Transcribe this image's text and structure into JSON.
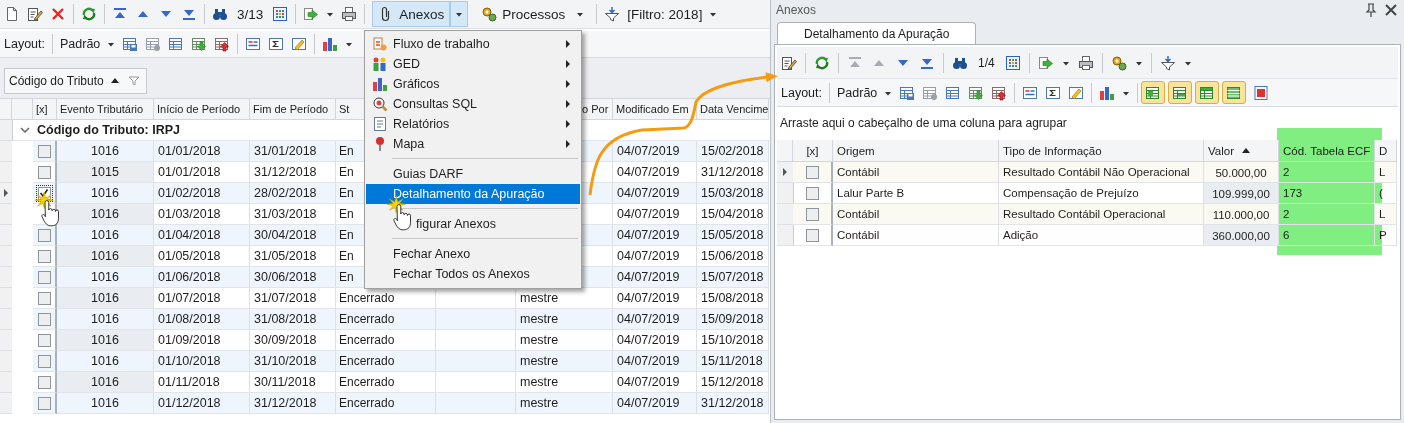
{
  "left": {
    "toolbar": {
      "record_position": "3/13",
      "anexos_button": {
        "label": "Anexos",
        "pressed": true
      },
      "processos_button": {
        "label": "Processos",
        "pressed": false
      },
      "filter_label": "[Filtro: 2018]"
    },
    "layout_bar": {
      "label": "Layout:",
      "preset": "Padrão"
    },
    "group_panel": {
      "chip": {
        "label": "Código do Tributo",
        "sorted_ascending": true
      }
    },
    "table": {
      "columns": [
        {
          "label": "[x]"
        },
        {
          "label": "Evento Tributário"
        },
        {
          "label": "Início de Período"
        },
        {
          "label": "Fim de Período"
        },
        {
          "label": "St"
        },
        {
          "label": "o Por"
        },
        {
          "label": "Modificado Em"
        },
        {
          "label": "Data Vencime"
        }
      ],
      "group": {
        "label": "Código do Tributo: IRPJ",
        "expanded": true
      },
      "rows": [
        {
          "current": false,
          "checked": false,
          "evento": "1016",
          "inicio": "01/01/2018",
          "fim": "31/01/2018",
          "status": "En",
          "modificado_em": "04/07/2019",
          "vencimento": "15/02/2018"
        },
        {
          "current": false,
          "checked": false,
          "evento": "1015",
          "inicio": "01/01/2018",
          "fim": "31/12/2018",
          "status": "En",
          "modificado_em": "04/07/2019",
          "vencimento": "31/12/2018"
        },
        {
          "current": true,
          "checked": true,
          "evento": "1016",
          "inicio": "01/02/2018",
          "fim": "28/02/2018",
          "status": "En",
          "modificado_em": "04/07/2019",
          "vencimento": "15/03/2018"
        },
        {
          "current": false,
          "evento": "1016",
          "inicio": "01/03/2018",
          "fim": "31/03/2018",
          "status": "En",
          "modificado_em": "04/07/2019",
          "vencimento": "15/04/2018"
        },
        {
          "current": false,
          "checked": false,
          "evento": "1016",
          "inicio": "01/04/2018",
          "fim": "30/04/2018",
          "status": "En",
          "modificado_em": "04/07/2019",
          "vencimento": "15/05/2018"
        },
        {
          "current": false,
          "checked": false,
          "evento": "1016",
          "inicio": "01/05/2018",
          "fim": "31/05/2018",
          "status": "En",
          "modificado_em": "04/07/2019",
          "vencimento": "15/06/2018"
        },
        {
          "current": false,
          "checked": false,
          "evento": "1016",
          "inicio": "01/06/2018",
          "fim": "30/06/2018",
          "status": "En",
          "modificado_em": "04/07/2019",
          "vencimento": "15/07/2018"
        },
        {
          "current": false,
          "checked": false,
          "evento": "1016",
          "inicio": "01/07/2018",
          "fim": "31/07/2018",
          "status": "Encerrado",
          "modificado_por": "mestre",
          "modificado_em": "04/07/2019",
          "vencimento": "15/08/2018"
        },
        {
          "current": false,
          "checked": false,
          "evento": "1016",
          "inicio": "01/08/2018",
          "fim": "31/08/2018",
          "status": "Encerrado",
          "modificado_por": "mestre",
          "modificado_em": "04/07/2019",
          "vencimento": "15/09/2018"
        },
        {
          "current": false,
          "checked": false,
          "evento": "1016",
          "inicio": "01/09/2018",
          "fim": "30/09/2018",
          "status": "Encerrado",
          "modificado_por": "mestre",
          "modificado_em": "04/07/2019",
          "vencimento": "15/10/2018"
        },
        {
          "current": false,
          "checked": false,
          "evento": "1016",
          "inicio": "01/10/2018",
          "fim": "31/10/2018",
          "status": "Encerrado",
          "modificado_por": "mestre",
          "modificado_em": "04/07/2019",
          "vencimento": "15/11/2018"
        },
        {
          "current": false,
          "checked": false,
          "evento": "1016",
          "inicio": "01/11/2018",
          "fim": "30/11/2018",
          "status": "Encerrado",
          "modificado_por": "mestre",
          "modificado_em": "04/07/2019",
          "vencimento": "15/12/2018"
        },
        {
          "current": false,
          "checked": false,
          "evento": "1016",
          "inicio": "01/12/2018",
          "fim": "31/12/2018",
          "status": "Encerrado",
          "modificado_por": "mestre",
          "modificado_em": "04/07/2019",
          "vencimento": "31/12/2018"
        }
      ]
    }
  },
  "menu": {
    "items": [
      {
        "kind": "submenu",
        "label": "Fluxo de trabalho",
        "selected": false
      },
      {
        "kind": "submenu",
        "label": "GED",
        "selected": false
      },
      {
        "kind": "submenu",
        "label": "Gráficos",
        "selected": false
      },
      {
        "kind": "submenu",
        "label": "Consultas SQL",
        "selected": false
      },
      {
        "kind": "submenu",
        "label": "Relatórios",
        "selected": false
      },
      {
        "kind": "submenu",
        "label": "Mapa",
        "selected": false
      },
      {
        "kind": "separator"
      },
      {
        "kind": "item",
        "label": "Guias DARF",
        "selected": false
      },
      {
        "kind": "item",
        "label": "Detalhamento da Apuração",
        "selected": true
      },
      {
        "kind": "separator"
      },
      {
        "kind": "item",
        "label": "figurar Anexos",
        "selected": false
      },
      {
        "kind": "separator"
      },
      {
        "kind": "item",
        "label": "Fechar Anexo",
        "selected": false
      },
      {
        "kind": "item",
        "label": "Fechar Todos os Anexos",
        "selected": false
      }
    ]
  },
  "panel": {
    "title": "Anexos",
    "tab": {
      "label": "Detalhamento da Apuração",
      "selected": true
    },
    "record_position": "1/4",
    "layout_bar": {
      "label": "Layout:",
      "preset": "Padrão"
    },
    "view_toggles": [
      {
        "on": true
      },
      {
        "on": true
      },
      {
        "on": true
      },
      {
        "on": true
      },
      {
        "on": false
      }
    ],
    "group_hint": "Arraste aqui o cabeçalho de uma coluna para agrupar",
    "table": {
      "columns": [
        {
          "label": "[x]"
        },
        {
          "label": "Origem"
        },
        {
          "label": "Tipo de Informação"
        },
        {
          "label": "Valor",
          "sorted_ascending": true
        },
        {
          "label": "Cód. Tabela ECF",
          "highlighted": true
        },
        {
          "label": "D"
        }
      ],
      "rows": [
        {
          "current": true,
          "checked": false,
          "origem": "Contábil",
          "tipo": "Resultado Contábil Não Operacional",
          "valor": "50.000,00",
          "cod": "2",
          "column_6": "L"
        },
        {
          "current": false,
          "checked": false,
          "origem": "Lalur Parte B",
          "tipo": "Compensação de Prejuízo",
          "valor": "109.999,00",
          "cod": "173",
          "column_6": "("
        },
        {
          "current": false,
          "checked": false,
          "origem": "Contábil",
          "tipo": "Resultado Contábil Operacional",
          "valor": "110.000,00",
          "cod": "2",
          "column_6": "L"
        },
        {
          "current": false,
          "checked": false,
          "origem": "Contábil",
          "tipo": "Adição",
          "valor": "360.000,00",
          "cod": "6",
          "column_6": "P"
        }
      ]
    }
  }
}
